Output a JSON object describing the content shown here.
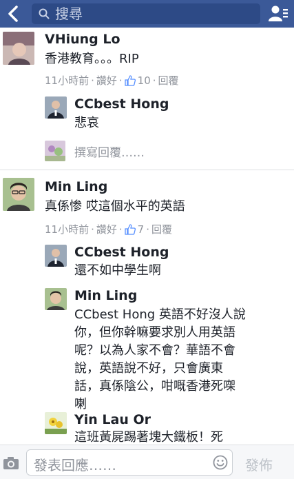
{
  "header": {
    "search_placeholder": "搜尋"
  },
  "comments": [
    {
      "author": "VHiung Lo",
      "text": "香港教育。。。RIP",
      "time": "11小時前",
      "like_label": "讚好",
      "like_count": "10",
      "reply_label": "回覆",
      "replies": [
        {
          "author": "CCbest Hong",
          "text": "悲哀"
        }
      ],
      "write_reply_placeholder": "撰寫回覆……"
    },
    {
      "author": "Min Ling",
      "text": "真係惨 哎這個水平的英語",
      "time": "11小時前",
      "like_label": "讚好",
      "like_count": "7",
      "reply_label": "回覆",
      "replies": [
        {
          "author": "CCbest Hong",
          "text": "還不如中學生啊"
        },
        {
          "author": "Min Ling",
          "text_lines": [
            "CCbest Hong 英語不好沒人說",
            "你，但你幹嘛要求別人用英語",
            "呢？以為人家不會？華語不會",
            "說，英語說不好，只會廣東",
            "話，真係陰公，咁嘅香港死㗎",
            "喇"
          ]
        },
        {
          "author": "Yin Lau Or",
          "text": "這班黃屍踢著塊大鐵板！死"
        }
      ]
    }
  ],
  "composer": {
    "placeholder": "發表回應……",
    "send_label": "發佈"
  },
  "colors": {
    "header_bg": "#3b5998",
    "meta_gray": "#90949c"
  }
}
